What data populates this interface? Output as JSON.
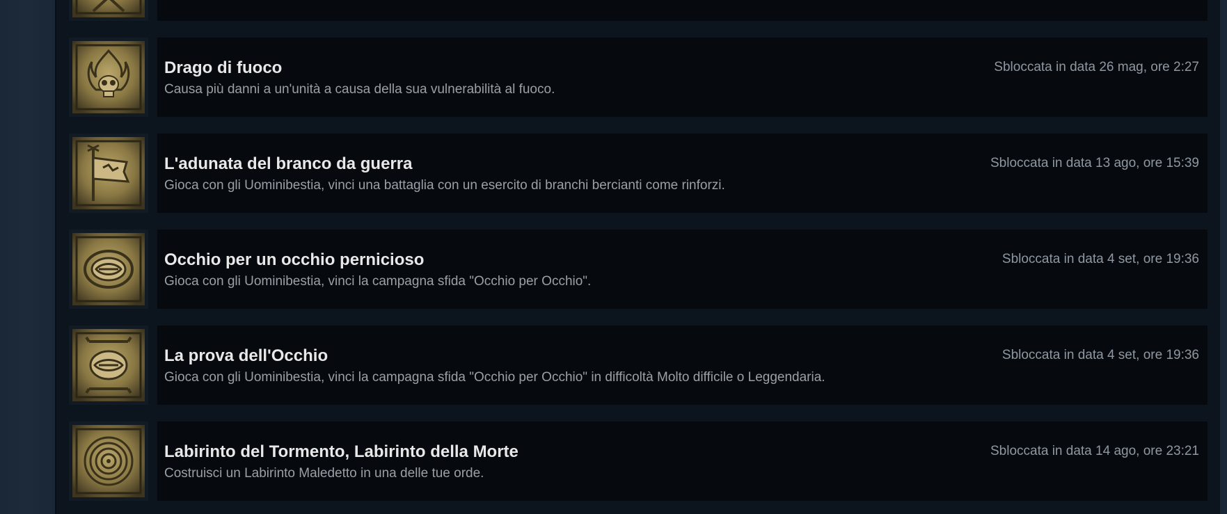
{
  "achievements": [
    {
      "title": "",
      "description": "",
      "unlocked": "",
      "icon": "crossed-blades-icon"
    },
    {
      "title": "Drago di fuoco",
      "description": "Causa più danni a un'unità a causa della sua vulnerabilità al fuoco.",
      "unlocked": "Sbloccata in data 26 mag, ore 2:27",
      "icon": "flaming-skull-icon"
    },
    {
      "title": "L'adunata del branco da guerra",
      "description": "Gioca con gli Uominibestia, vinci una battaglia con un esercito di branchi bercianti come rinforzi.",
      "unlocked": "Sbloccata in data 13 ago, ore 15:39",
      "icon": "war-banner-icon"
    },
    {
      "title": "Occhio per un occhio pernicioso",
      "description": "Gioca con gli Uominibestia, vinci la campagna sfida \"Occhio per Occhio\".",
      "unlocked": "Sbloccata in data 4 set, ore 19:36",
      "icon": "eye-emblem-icon"
    },
    {
      "title": "La prova dell'Occhio",
      "description": "Gioca con gli Uominibestia, vinci la campagna sfida \"Occhio per Occhio\" in difficoltà Molto difficile o Leggendaria.",
      "unlocked": "Sbloccata in data 4 set, ore 19:36",
      "icon": "eye-emblem-horned-icon"
    },
    {
      "title": "Labirinto del Tormento, Labirinto della Morte",
      "description": "Costruisci un Labirinto Maledetto in una delle tue orde.",
      "unlocked": "Sbloccata in data 14 ago, ore 23:21",
      "icon": "labyrinth-icon"
    }
  ],
  "colors": {
    "page_background": "#1b2838",
    "row_background": "#060a0f",
    "title": "#e8e8e8",
    "description": "#9aa0a6",
    "date": "#8f98a0",
    "icon_gold": "#9a8750"
  }
}
